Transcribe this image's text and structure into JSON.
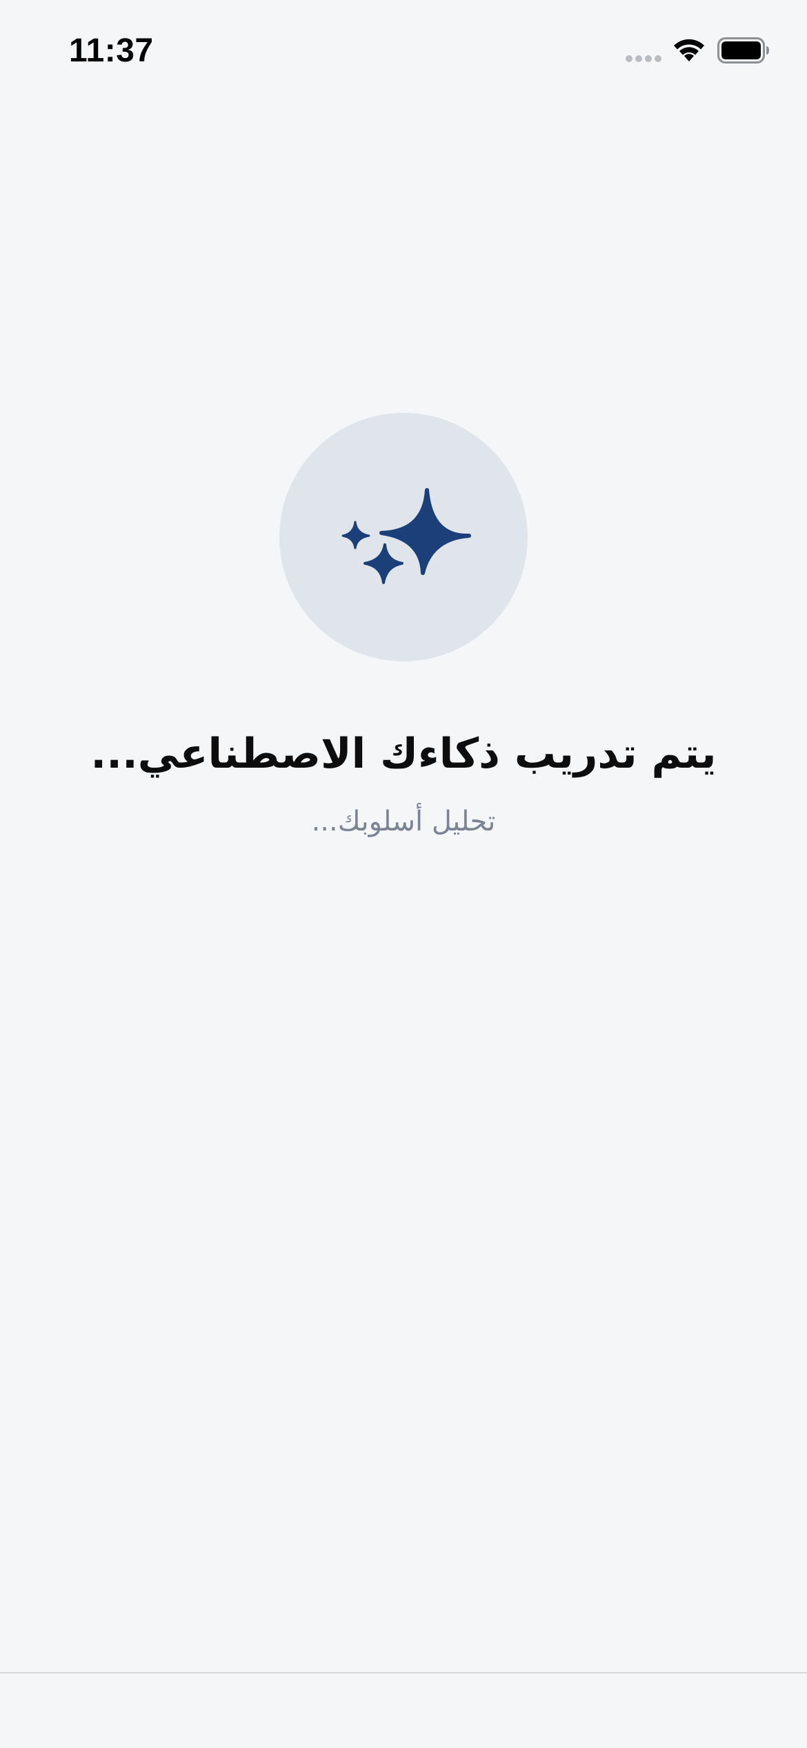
{
  "status_bar": {
    "time": "11:37",
    "icons": [
      "signal-dots-icon",
      "wifi-icon",
      "battery-icon"
    ]
  },
  "loader": {
    "icon": "sparkles-icon",
    "icon_color": "#1b3f78",
    "circle_color": "#e0e5eb"
  },
  "content": {
    "title": "يتم تدريب ذكاءك الاصطناعي...",
    "subtitle": "تحليل أسلوبك..."
  },
  "colors": {
    "background": "#f5f6f8",
    "title": "#0d0d0d",
    "subtitle": "#7a8494"
  }
}
